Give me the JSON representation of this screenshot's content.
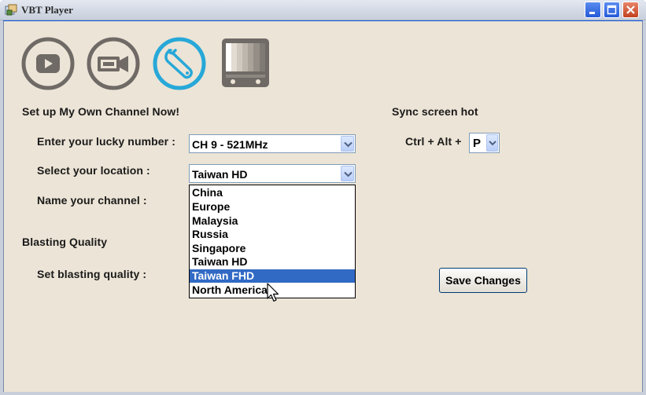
{
  "window": {
    "title": "VBT Player",
    "colors": {
      "client_bg": "#ece4d6",
      "accent": "#316ac5",
      "icon_active": "#27a8d8",
      "icon_gray": "#6f6a66"
    }
  },
  "nav": [
    {
      "icon": "play-icon",
      "active": false
    },
    {
      "icon": "video-camera-icon",
      "active": false
    },
    {
      "icon": "wrench-icon",
      "active": true
    },
    {
      "icon": "tv-test-pattern-icon",
      "active": false
    }
  ],
  "section_channel": {
    "heading": "Set up My Own Channel Now!",
    "lucky_number_label": "Enter your lucky number :",
    "lucky_number_value": "CH 9 - 521MHz",
    "location_label": "Select your location :",
    "location_value": "Taiwan HD",
    "name_label": "Name your channel :"
  },
  "location_options": [
    {
      "label": "China",
      "selected": false
    },
    {
      "label": "Europe",
      "selected": false
    },
    {
      "label": "Malaysia",
      "selected": false
    },
    {
      "label": "Russia",
      "selected": false
    },
    {
      "label": "Singapore",
      "selected": false
    },
    {
      "label": "Taiwan HD",
      "selected": false
    },
    {
      "label": "Taiwan FHD",
      "selected": true
    },
    {
      "label": "North America",
      "selected": false
    }
  ],
  "section_quality": {
    "heading": "Blasting Quality",
    "quality_label": "Set blasting quality :"
  },
  "sync": {
    "heading": "Sync screen hot",
    "hotkey_prefix": "Ctrl + Alt +",
    "hotkey_value": "P"
  },
  "actions": {
    "save_label": "Save Changes"
  }
}
